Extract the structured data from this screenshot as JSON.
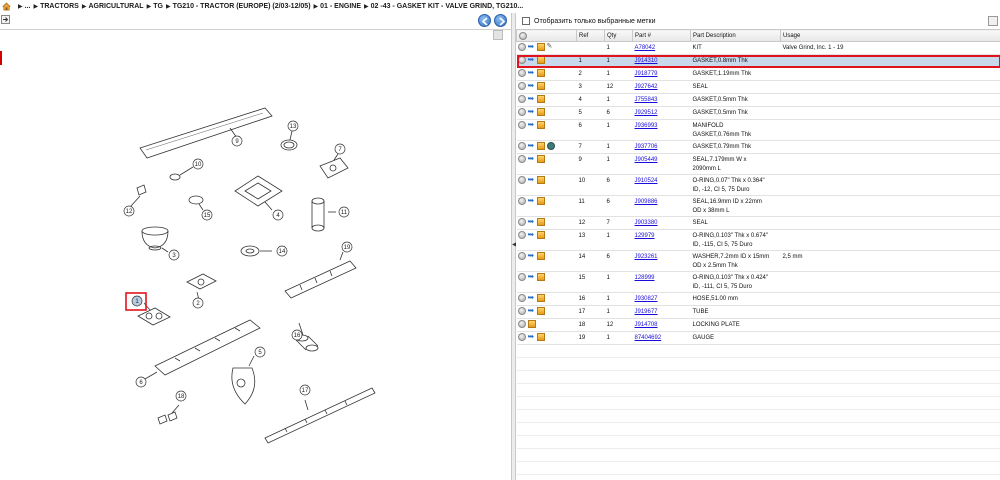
{
  "breadcrumb": {
    "items": [
      "...",
      "TRACTORS",
      "AGRICULTURAL",
      "TG",
      "TG210 - TRACTOR (EUROPE) (2/03-12/05)",
      "01 - ENGINE",
      "02 -43 - GASKET KIT - VALVE GRIND, TG210..."
    ]
  },
  "filter": {
    "label": "Отобразить только выбранные метки",
    "checked": false
  },
  "table": {
    "columns": [
      "",
      "Ref",
      "Qty",
      "Part #",
      "Part Description",
      "Usage"
    ],
    "rows": [
      {
        "ref": "",
        "qty": "1",
        "part": "A78042",
        "desc": [
          "KIT"
        ],
        "usage": "Valve Grind, Inc. 1 - 19",
        "icons": [
          "plus",
          "arrow",
          "box",
          "link"
        ]
      },
      {
        "ref": "1",
        "qty": "1",
        "part": "J914310",
        "desc": [
          "GASKET,0.8mm Thk"
        ],
        "usage": "",
        "icons": [
          "plus",
          "arrow",
          "box"
        ],
        "selected": true
      },
      {
        "ref": "2",
        "qty": "1",
        "part": "J918779",
        "desc": [
          "GASKET,1.19mm Thk"
        ],
        "usage": "",
        "icons": [
          "plus",
          "arrow",
          "box"
        ]
      },
      {
        "ref": "3",
        "qty": "12",
        "part": "J927642",
        "desc": [
          "SEAL"
        ],
        "usage": "",
        "icons": [
          "plus",
          "arrow",
          "box"
        ]
      },
      {
        "ref": "4",
        "qty": "1",
        "part": "J755843",
        "desc": [
          "GASKET,0.5mm Thk"
        ],
        "usage": "",
        "icons": [
          "plus",
          "arrow",
          "box"
        ]
      },
      {
        "ref": "5",
        "qty": "6",
        "part": "J929512",
        "desc": [
          "GASKET,0.5mm Thk"
        ],
        "usage": "",
        "icons": [
          "plus",
          "arrow",
          "box"
        ]
      },
      {
        "ref": "6",
        "qty": "1",
        "part": "J936993",
        "desc": [
          "MANIFOLD",
          "GASKET,0.76mm Thk"
        ],
        "usage": "",
        "icons": [
          "plus",
          "arrow",
          "box"
        ]
      },
      {
        "ref": "7",
        "qty": "1",
        "part": "J937706",
        "desc": [
          "GASKET,0.79mm Thk"
        ],
        "usage": "",
        "icons": [
          "plus",
          "arrow",
          "box",
          "gear"
        ]
      },
      {
        "ref": "9",
        "qty": "1",
        "part": "J905449",
        "desc": [
          "SEAL,7.179mm W x",
          "2090mm L"
        ],
        "usage": "",
        "icons": [
          "plus",
          "arrow",
          "box"
        ]
      },
      {
        "ref": "10",
        "qty": "6",
        "part": "J910524",
        "desc": [
          "O-RING,0.07\" Thk x 0.364\"",
          "ID, -12, CI 5, 75 Duro"
        ],
        "usage": "",
        "icons": [
          "plus",
          "arrow",
          "box"
        ]
      },
      {
        "ref": "11",
        "qty": "6",
        "part": "J909886",
        "desc": [
          "SEAL,16.9mm ID x 22mm",
          "OD x 38mm L"
        ],
        "usage": "",
        "icons": [
          "plus",
          "arrow",
          "box"
        ]
      },
      {
        "ref": "12",
        "qty": "7",
        "part": "J903380",
        "desc": [
          "SEAL"
        ],
        "usage": "",
        "icons": [
          "plus",
          "arrow",
          "box"
        ]
      },
      {
        "ref": "13",
        "qty": "1",
        "part": "129979",
        "desc": [
          "O-RING,0.103\" Thk x 0.674\"",
          "ID, -115, CI 5, 75 Duro"
        ],
        "usage": "",
        "icons": [
          "plus",
          "arrow",
          "box"
        ]
      },
      {
        "ref": "14",
        "qty": "6",
        "part": "J923261",
        "desc": [
          "WASHER,7.2mm ID x 15mm",
          "OD x 2.5mm Thk"
        ],
        "usage": "2,5 mm",
        "icons": [
          "plus",
          "arrow",
          "box"
        ]
      },
      {
        "ref": "15",
        "qty": "1",
        "part": "128999",
        "desc": [
          "O-RING,0.103\" Thk x 0.424\"",
          "ID, -111, CI 5, 75 Duro"
        ],
        "usage": "",
        "icons": [
          "plus",
          "arrow",
          "box"
        ]
      },
      {
        "ref": "16",
        "qty": "1",
        "part": "J930827",
        "desc": [
          "HOSE,51.00 mm"
        ],
        "usage": "",
        "icons": [
          "plus",
          "arrow",
          "box"
        ]
      },
      {
        "ref": "17",
        "qty": "1",
        "part": "J919677",
        "desc": [
          "TUBE"
        ],
        "usage": "",
        "icons": [
          "plus",
          "arrow",
          "box"
        ]
      },
      {
        "ref": "18",
        "qty": "12",
        "part": "J914708",
        "desc": [
          "LOCKING PLATE"
        ],
        "usage": "",
        "icons": [
          "plus",
          "box"
        ]
      },
      {
        "ref": "19",
        "qty": "1",
        "part": "87404692",
        "desc": [
          "GAUGE"
        ],
        "usage": "",
        "icons": [
          "plus",
          "arrow",
          "box"
        ]
      }
    ]
  },
  "diagram": {
    "callouts": [
      "1",
      "2",
      "3",
      "4",
      "5",
      "6",
      "7",
      "9",
      "10",
      "11",
      "12",
      "13",
      "14",
      "15",
      "16",
      "17",
      "18",
      "19"
    ],
    "selected_callout": "1"
  },
  "colors": {
    "selection_outline": "#e0141e",
    "selected_row_bg": "#c9d9ec",
    "link": "#1a0ddb",
    "nav_button": "#2e6fc4"
  }
}
